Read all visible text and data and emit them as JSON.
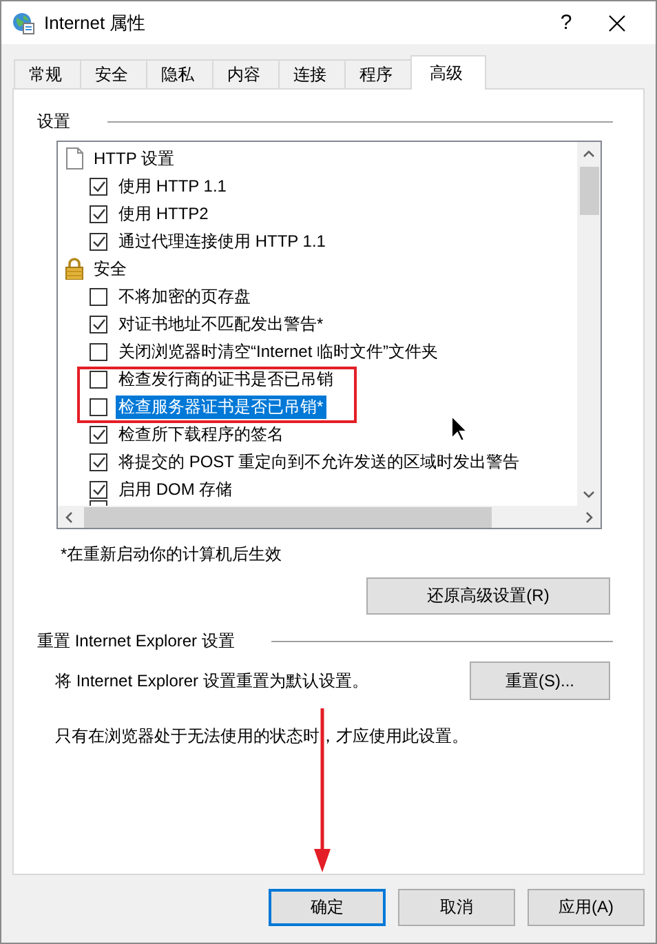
{
  "window": {
    "title": "Internet 属性",
    "help": "?"
  },
  "tabs": [
    {
      "label": "常规",
      "selected": false
    },
    {
      "label": "安全",
      "selected": false
    },
    {
      "label": "隐私",
      "selected": false
    },
    {
      "label": "内容",
      "selected": false
    },
    {
      "label": "连接",
      "selected": false
    },
    {
      "label": "程序",
      "selected": false
    },
    {
      "label": "高级",
      "selected": true
    }
  ],
  "settings": {
    "title": "设置",
    "categories": [
      {
        "label": "HTTP 设置",
        "children": [
          {
            "label": "使用 HTTP 1.1",
            "checked": true,
            "selected": false
          },
          {
            "label": "使用 HTTP2",
            "checked": true,
            "selected": false
          },
          {
            "label": "通过代理连接使用 HTTP 1.1",
            "checked": true,
            "selected": false
          }
        ]
      },
      {
        "label": "安全",
        "children": [
          {
            "label": "不将加密的页存盘",
            "checked": false,
            "selected": false
          },
          {
            "label": "对证书地址不匹配发出警告*",
            "checked": true,
            "selected": false
          },
          {
            "label": "关闭浏览器时清空“Internet 临时文件”文件夹",
            "checked": false,
            "selected": false
          },
          {
            "label": "检查发行商的证书是否已吊销",
            "checked": false,
            "selected": false
          },
          {
            "label": "检查服务器证书是否已吊销*",
            "checked": false,
            "selected": true
          },
          {
            "label": "检查所下载程序的签名",
            "checked": true,
            "selected": false
          },
          {
            "label": "将提交的 POST 重定向到不允许发送的区域时发出警告",
            "checked": true,
            "selected": false
          },
          {
            "label": "启用 DOM 存储",
            "checked": true,
            "selected": false
          }
        ]
      }
    ],
    "note": "*在重新启动你的计算机后生效",
    "restore_button": "还原高级设置(R)"
  },
  "reset": {
    "title": "重置 Internet Explorer 设置",
    "description": "将 Internet Explorer 设置重置为默认设置。",
    "button": "重置(S)...",
    "warning": "只有在浏览器处于无法使用的状态时，才应使用此设置。"
  },
  "buttons": [
    {
      "label": "确定",
      "focused": true
    },
    {
      "label": "取消",
      "focused": false
    },
    {
      "label": "应用(A)",
      "focused": false
    }
  ]
}
